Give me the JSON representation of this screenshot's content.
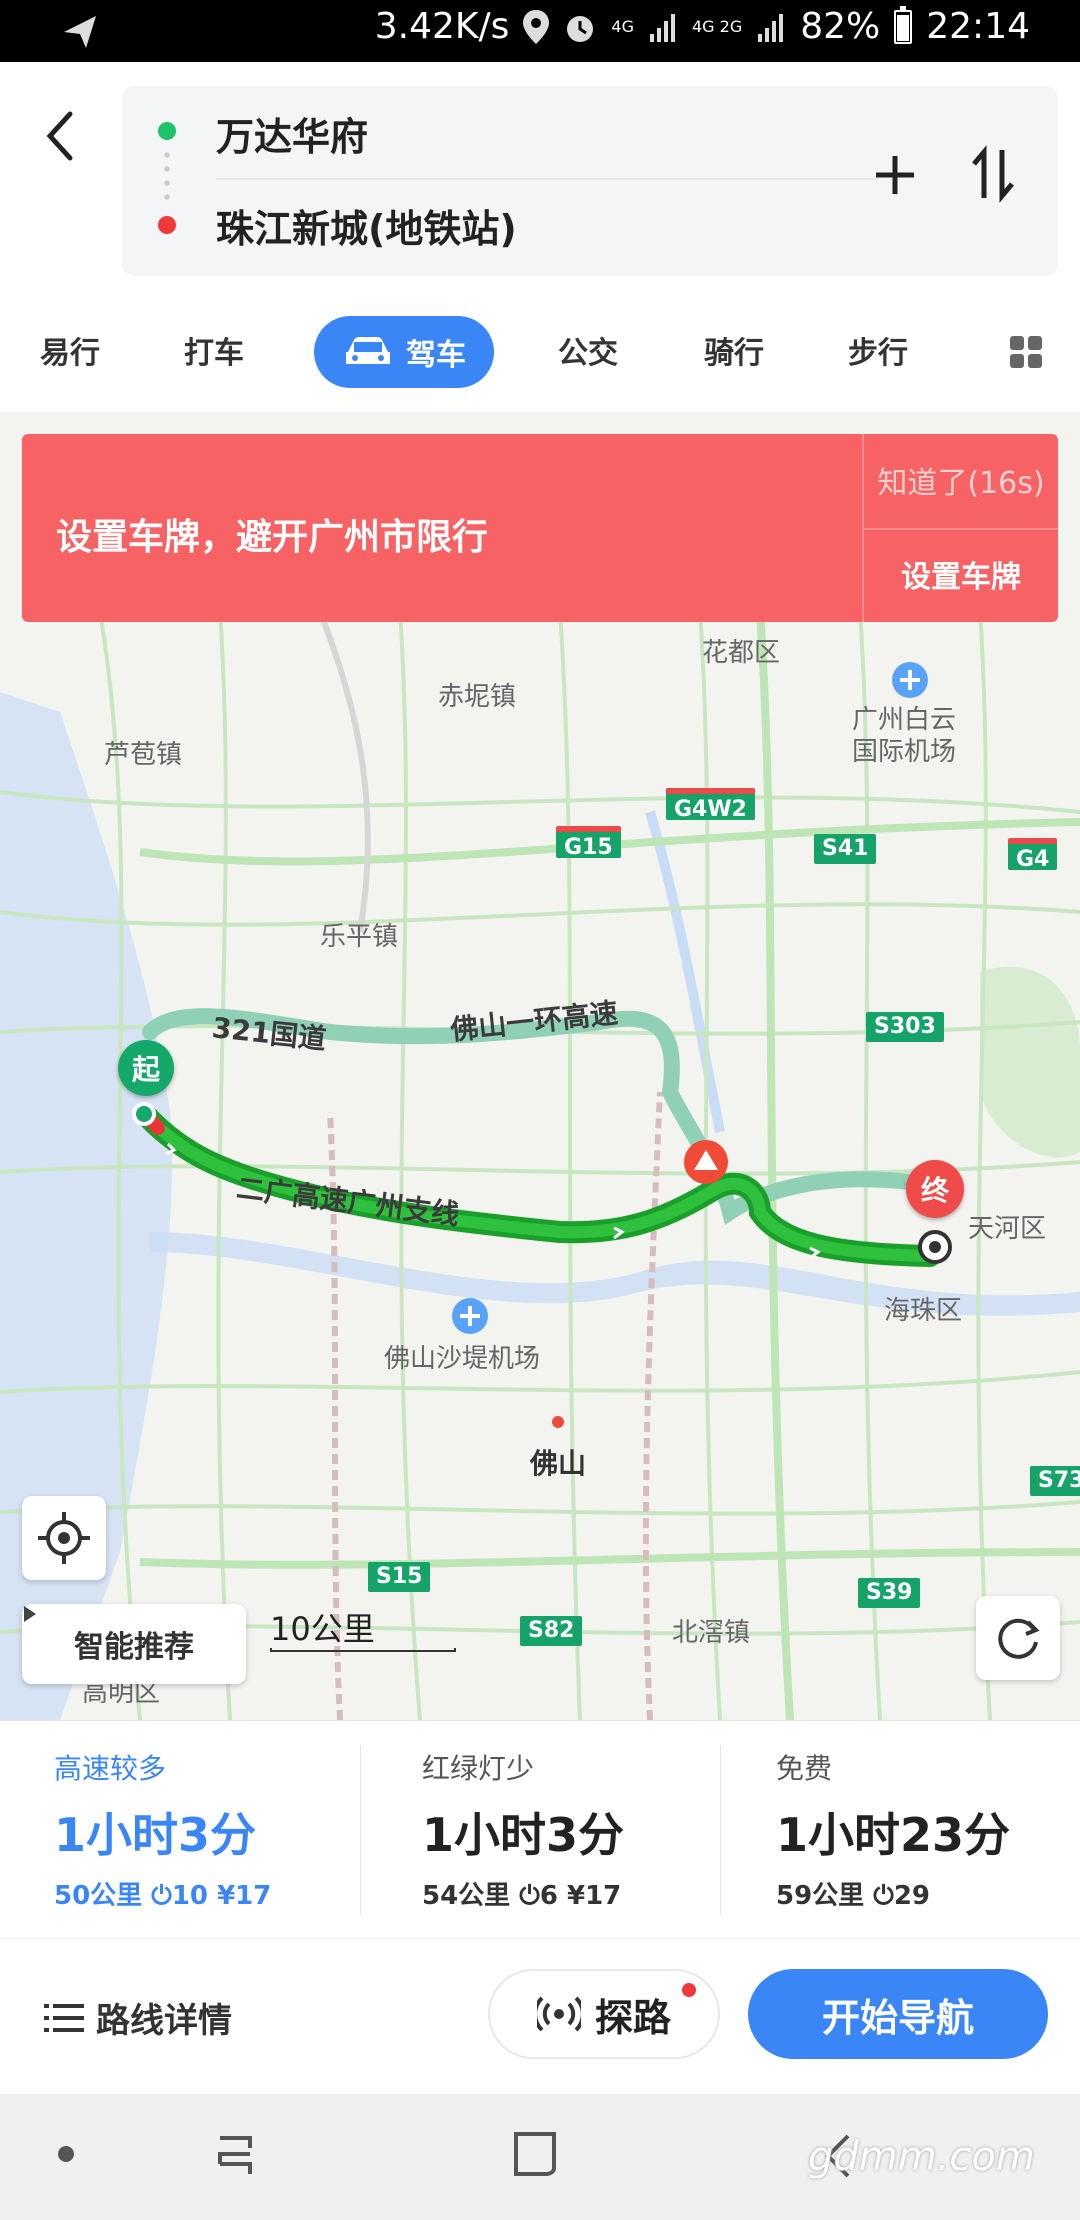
{
  "status_bar": {
    "speed": "3.42K/s",
    "battery": "82%",
    "time": "22:14",
    "net1": "4G",
    "net2": "4G 2G"
  },
  "header": {
    "from": "万达华府",
    "to": "珠江新城(地铁站)"
  },
  "tabs": [
    "易行",
    "打车",
    "驾车",
    "公交",
    "骑行",
    "步行"
  ],
  "active_tab": "驾车",
  "banner": {
    "message": "设置车牌，避开广州市限行",
    "dismiss": "知道了(16s)",
    "action": "设置车牌"
  },
  "map": {
    "places": {
      "huadu": "花都区",
      "chini": "赤坭镇",
      "baiyun_airport": "广州白云\n国际机场",
      "lutao": "芦苞镇",
      "leping": "乐平镇",
      "tianhe": "天河区",
      "haizhu": "海珠区",
      "foshan_airport": "佛山沙堤机场",
      "foshan": "佛山",
      "beijiao": "北滘镇",
      "gaoming": "高明区"
    },
    "roads": {
      "g4w2": "G4W2",
      "g15": "G15",
      "s41": "S41",
      "g4": "G4",
      "s303": "S303",
      "s15": "S15",
      "s82": "S82",
      "s39": "S39",
      "s73": "S73",
      "guodao": "321国道",
      "huangao": "佛山一环高速",
      "erguang": "二广高速广州支线"
    },
    "start_label": "起",
    "end_label": "终",
    "route_color": "#17a726",
    "alt_route_color": "#8fd0b6",
    "smart_recommend": "智能推荐",
    "scale": "10公里"
  },
  "routes": [
    {
      "tag": "高速较多",
      "time": "1小时3分",
      "distance": "50公里",
      "lights": "10",
      "toll": "¥17"
    },
    {
      "tag": "红绿灯少",
      "time": "1小时3分",
      "distance": "54公里",
      "lights": "6",
      "toll": "¥17"
    },
    {
      "tag": "免费",
      "time": "1小时23分",
      "distance": "59公里",
      "lights": "29",
      "toll": ""
    }
  ],
  "bottom": {
    "details": "路线详情",
    "explore": "探路",
    "start_nav": "开始导航"
  },
  "watermark": "gdmm.com"
}
